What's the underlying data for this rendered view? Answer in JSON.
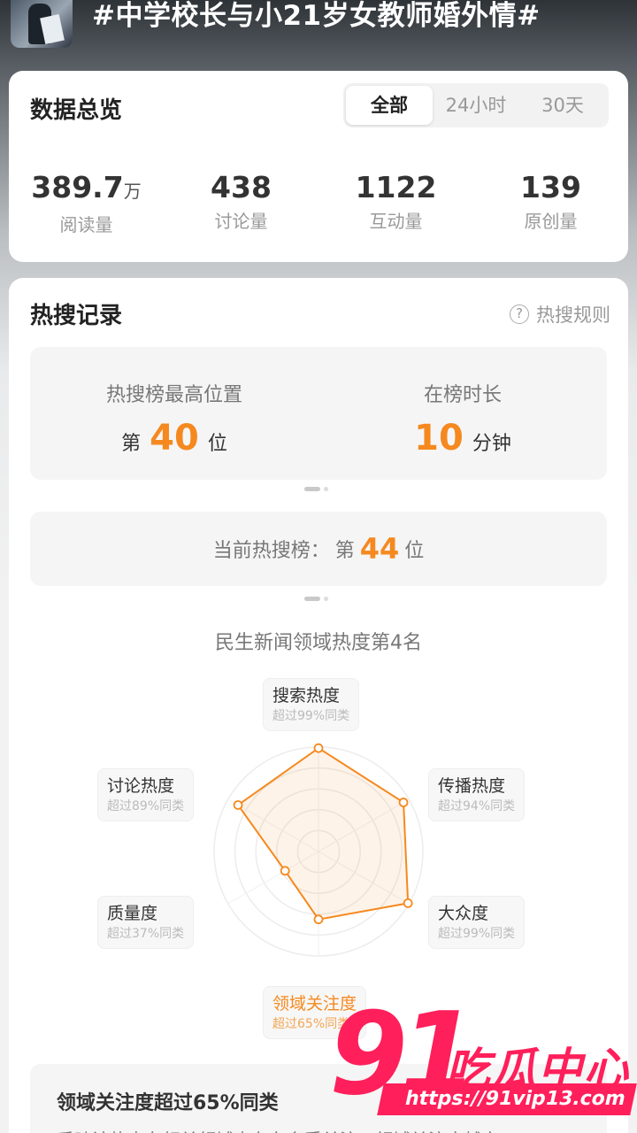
{
  "header": {
    "topic_title": "#中学校长与小21岁女教师婚外情#"
  },
  "overview": {
    "title": "数据总览",
    "tabs": [
      {
        "label": "全部",
        "active": true
      },
      {
        "label": "24小时",
        "active": false
      },
      {
        "label": "30天",
        "active": false
      }
    ],
    "stats": [
      {
        "value": "389.7",
        "unit": "万",
        "label": "阅读量"
      },
      {
        "value": "438",
        "unit": "",
        "label": "讨论量"
      },
      {
        "value": "1122",
        "unit": "",
        "label": "互动量"
      },
      {
        "value": "139",
        "unit": "",
        "label": "原创量"
      }
    ]
  },
  "hot_search": {
    "title": "热搜记录",
    "rules_label": "热搜规则",
    "highest": {
      "label": "热搜榜最高位置",
      "prefix": "第",
      "value": "40",
      "suffix": "位"
    },
    "duration": {
      "label": "在榜时长",
      "value": "10",
      "unit": "分钟"
    },
    "current": {
      "label": "当前热搜榜：",
      "prefix": "第",
      "value": "44",
      "suffix": "位"
    }
  },
  "domain": {
    "title": "民生新闻领域热度第4名",
    "metrics": [
      {
        "name": "搜索热度",
        "sub": "超过99%同类",
        "value": 99
      },
      {
        "name": "传播热度",
        "sub": "超过94%同类",
        "value": 94
      },
      {
        "name": "大众度",
        "sub": "超过99%同类",
        "value": 99
      },
      {
        "name": "领域关注度",
        "sub": "超过65%同类",
        "value": 65
      },
      {
        "name": "质量度",
        "sub": "超过37%同类",
        "value": 37
      },
      {
        "name": "讨论热度",
        "sub": "超过89%同类",
        "value": 89
      }
    ],
    "summary_title": "领域关注度超过65%同类",
    "summary_text": "反映该热点在相关领域内存在多受关注，领域关注度越高"
  },
  "watermark": {
    "number": "91",
    "text": "吃瓜中心",
    "url": "https://91vip13.com"
  },
  "colors": {
    "accent": "#f5891f",
    "watermark": "#ff1f5a"
  }
}
